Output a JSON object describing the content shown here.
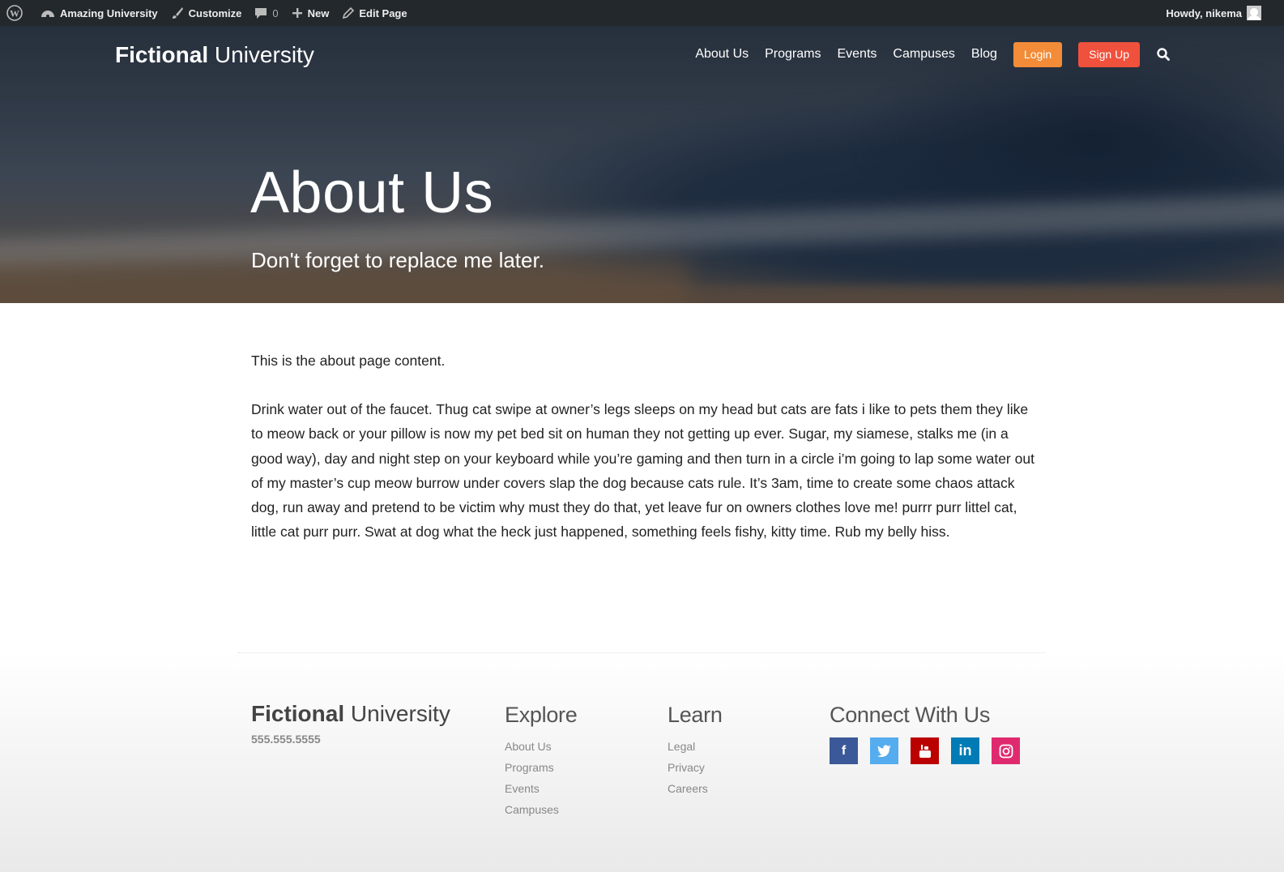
{
  "adminbar": {
    "site_name": "Amazing University",
    "customize": "Customize",
    "comments_count": "0",
    "new_label": "New",
    "edit_page": "Edit Page",
    "howdy": "Howdy, nikema"
  },
  "header": {
    "logo_bold": "Fictional",
    "logo_light": "University",
    "nav": [
      "About Us",
      "Programs",
      "Events",
      "Campuses",
      "Blog"
    ],
    "login": "Login",
    "signup": "Sign Up",
    "login_color": "#f28c38",
    "signup_color": "#f0513c"
  },
  "hero": {
    "title": "About Us",
    "subtitle": "Don't forget to replace me later."
  },
  "content": {
    "p1": "This is the about page content.",
    "p2": "Drink water out of the faucet. Thug cat swipe at owner’s legs sleeps on my head but cats are fats i like to pets them they like to meow back or your pillow is now my pet bed sit on human they not getting up ever. Sugar, my siamese, stalks me (in a good way), day and night step on your keyboard while you’re gaming and then turn in a circle i’m going to lap some water out of my master’s cup meow burrow under covers slap the dog because cats rule. It’s 3am, time to create some chaos attack dog, run away and pretend to be victim why must they do that, yet leave fur on owners clothes love me! purrr purr littel cat, little cat purr purr. Swat at dog what the heck just happened, something feels fishy, kitty time. Rub my belly hiss."
  },
  "footer": {
    "logo_bold": "Fictional",
    "logo_light": "University",
    "phone": "555.555.5555",
    "explore": {
      "heading": "Explore",
      "links": [
        "About Us",
        "Programs",
        "Events",
        "Campuses"
      ]
    },
    "learn": {
      "heading": "Learn",
      "links": [
        "Legal",
        "Privacy",
        "Careers"
      ]
    },
    "connect": {
      "heading": "Connect With Us",
      "social": [
        {
          "icon": "facebook-icon",
          "color": "#3b5998"
        },
        {
          "icon": "twitter-icon",
          "color": "#55acee"
        },
        {
          "icon": "youtube-icon",
          "color": "#bb0000"
        },
        {
          "icon": "linkedin-icon",
          "color": "#007bb5"
        },
        {
          "icon": "instagram-icon",
          "color": "#e02a6f"
        }
      ]
    }
  }
}
